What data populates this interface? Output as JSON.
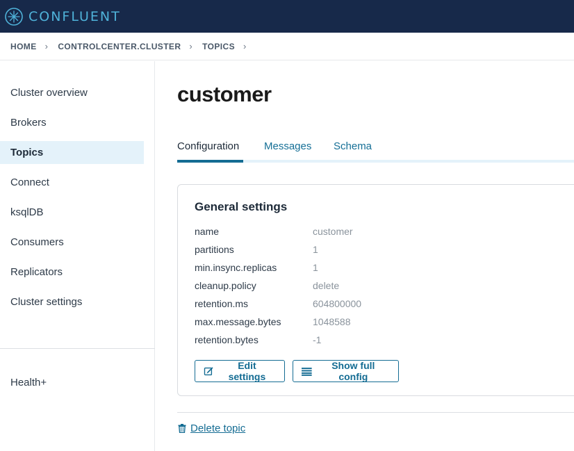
{
  "brand": {
    "name": "CONFLUENT",
    "icon": "confluent-logo-icon"
  },
  "breadcrumb": {
    "items": [
      "HOME",
      "CONTROLCENTER.CLUSTER",
      "TOPICS"
    ],
    "separator": "›"
  },
  "sidebar": {
    "items": [
      {
        "label": "Cluster overview"
      },
      {
        "label": "Brokers"
      },
      {
        "label": "Topics",
        "active": true
      },
      {
        "label": "Connect"
      },
      {
        "label": "ksqlDB"
      },
      {
        "label": "Consumers"
      },
      {
        "label": "Replicators"
      },
      {
        "label": "Cluster settings"
      }
    ],
    "footer_item": "Health+"
  },
  "main": {
    "title": "customer",
    "tabs": [
      {
        "label": "Configuration",
        "active": true
      },
      {
        "label": "Messages"
      },
      {
        "label": "Schema"
      }
    ],
    "card": {
      "title": "General settings",
      "settings": [
        {
          "key": "name",
          "value": "customer"
        },
        {
          "key": "partitions",
          "value": "1"
        },
        {
          "key": "min.insync.replicas",
          "value": "1"
        },
        {
          "key": "cleanup.policy",
          "value": "delete"
        },
        {
          "key": "retention.ms",
          "value": "604800000"
        },
        {
          "key": "max.message.bytes",
          "value": "1048588"
        },
        {
          "key": "retention.bytes",
          "value": "-1"
        }
      ],
      "edit_button": {
        "label": "Edit settings",
        "icon": "edit-icon"
      },
      "config_button": {
        "label": "Show full config",
        "icon": "list-icon"
      }
    },
    "delete_link": {
      "label": "Delete topic",
      "icon": "trash-icon"
    }
  },
  "colors": {
    "header_bg": "#17294a",
    "brand_accent": "#4fb2d9",
    "link": "#146c93",
    "active_nav_bg": "#e4f2fa"
  }
}
